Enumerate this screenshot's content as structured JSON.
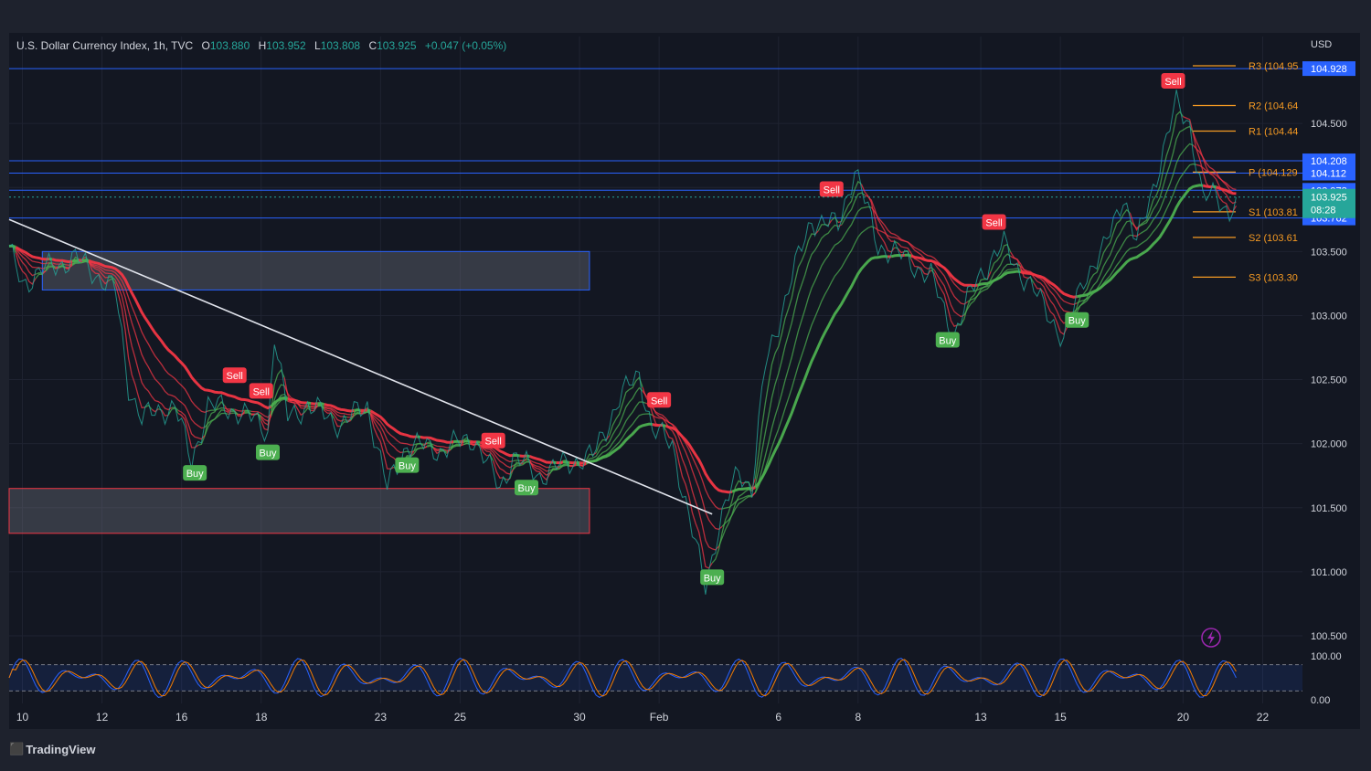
{
  "header": {
    "symbol": "U.S. Dollar Currency Index, 1h, TVC",
    "o_label": "O",
    "o": "103.880",
    "h_label": "H",
    "h": "103.952",
    "l_label": "L",
    "l": "103.808",
    "c_label": "C",
    "c": "103.925",
    "change": "+0.047 (+0.05%)"
  },
  "currency": "USD",
  "footer": {
    "brand": "TradingView"
  },
  "colors": {
    "background": "#131722",
    "frame": "#1e222d",
    "up": "#26a69a",
    "red": "#f23645",
    "green": "#4caf50",
    "orange": "#f59a23",
    "blue": "#2962ff",
    "text": "#b2b5be"
  },
  "chart_data": {
    "type": "line",
    "ylim": [
      100.4,
      105.05
    ],
    "y_ticks": [
      {
        "value": 104.5,
        "label": "104.500"
      },
      {
        "value": 104.0,
        "label": "104.000"
      },
      {
        "value": 103.5,
        "label": "103.500"
      },
      {
        "value": 103.0,
        "label": "103.000"
      },
      {
        "value": 102.5,
        "label": "102.500"
      },
      {
        "value": 102.0,
        "label": "102.000"
      },
      {
        "value": 101.5,
        "label": "101.500"
      },
      {
        "value": 101.0,
        "label": "101.000"
      },
      {
        "value": 100.5,
        "label": "100.500"
      }
    ],
    "x_ticks": [
      {
        "i": 4,
        "label": "10"
      },
      {
        "i": 28,
        "label": "12"
      },
      {
        "i": 52,
        "label": "16"
      },
      {
        "i": 76,
        "label": "18"
      },
      {
        "i": 112,
        "label": "23"
      },
      {
        "i": 136,
        "label": "25"
      },
      {
        "i": 172,
        "label": "30"
      },
      {
        "i": 196,
        "label": "Feb"
      },
      {
        "i": 232,
        "label": "6"
      },
      {
        "i": 256,
        "label": "8"
      },
      {
        "i": 293,
        "label": "13"
      },
      {
        "i": 317,
        "label": "15"
      },
      {
        "i": 354,
        "label": "20"
      },
      {
        "i": 378,
        "label": "22"
      }
    ],
    "n_slots": 390,
    "price_series": {
      "name": "DXY close",
      "anchors": [
        [
          0,
          103.5
        ],
        [
          4,
          103.25
        ],
        [
          10,
          103.35
        ],
        [
          20,
          103.45
        ],
        [
          32,
          103.2
        ],
        [
          36,
          102.45
        ],
        [
          40,
          102.2
        ],
        [
          50,
          102.3
        ],
        [
          55,
          101.85
        ],
        [
          60,
          102.3
        ],
        [
          70,
          102.25
        ],
        [
          78,
          102.1
        ],
        [
          80,
          102.85
        ],
        [
          84,
          102.2
        ],
        [
          90,
          102.3
        ],
        [
          100,
          102.15
        ],
        [
          108,
          102.3
        ],
        [
          114,
          101.65
        ],
        [
          120,
          102.0
        ],
        [
          130,
          101.95
        ],
        [
          140,
          102.05
        ],
        [
          148,
          101.65
        ],
        [
          152,
          101.9
        ],
        [
          160,
          101.75
        ],
        [
          168,
          101.85
        ],
        [
          176,
          101.9
        ],
        [
          184,
          102.35
        ],
        [
          190,
          102.55
        ],
        [
          194,
          102.1
        ],
        [
          200,
          102.0
        ],
        [
          206,
          101.3
        ],
        [
          210,
          100.9
        ],
        [
          214,
          101.35
        ],
        [
          220,
          101.8
        ],
        [
          224,
          101.65
        ],
        [
          228,
          102.6
        ],
        [
          236,
          103.3
        ],
        [
          242,
          103.75
        ],
        [
          250,
          103.7
        ],
        [
          255,
          104.15
        ],
        [
          262,
          103.55
        ],
        [
          270,
          103.45
        ],
        [
          278,
          103.3
        ],
        [
          285,
          102.85
        ],
        [
          292,
          103.3
        ],
        [
          300,
          103.55
        ],
        [
          306,
          103.3
        ],
        [
          314,
          103.0
        ],
        [
          318,
          102.8
        ],
        [
          324,
          103.3
        ],
        [
          330,
          103.5
        ],
        [
          336,
          103.95
        ],
        [
          340,
          103.55
        ],
        [
          346,
          104.1
        ],
        [
          352,
          104.65
        ],
        [
          356,
          104.5
        ],
        [
          360,
          103.9
        ],
        [
          364,
          103.95
        ],
        [
          368,
          103.8
        ],
        [
          370,
          103.925
        ]
      ]
    },
    "stoch_rsi": {
      "ylim": [
        0,
        100
      ],
      "ticks": [
        {
          "value": 100,
          "label": "100.00"
        },
        {
          "value": 0,
          "label": "0.00"
        }
      ],
      "bands": [
        80,
        20
      ]
    },
    "horizontal_levels": [
      {
        "name": "R3",
        "value": 104.95,
        "label": "R3 (104.95"
      },
      {
        "name": "R2",
        "value": 104.64,
        "label": "R2 (104.64"
      },
      {
        "name": "R1",
        "value": 104.44,
        "label": "R1 (104.44"
      },
      {
        "name": "P",
        "value": 104.12,
        "label": "P (104.129"
      },
      {
        "name": "S1",
        "value": 103.81,
        "label": "S1 (103.81"
      },
      {
        "name": "S2",
        "value": 103.61,
        "label": "S2 (103.61"
      },
      {
        "name": "S3",
        "value": 103.3,
        "label": "S3 (103.30"
      }
    ],
    "price_lines": [
      {
        "value": 104.928,
        "label": "104.928",
        "color": "#2962ff"
      },
      {
        "value": 104.208,
        "label": "104.208",
        "color": "#2962ff"
      },
      {
        "value": 104.112,
        "label": "104.112",
        "color": "#2962ff"
      },
      {
        "value": 103.978,
        "label": "103.978",
        "color": "#2962ff"
      },
      {
        "value": 103.762,
        "label": "103.762",
        "color": "#2962ff"
      }
    ],
    "last_price": {
      "value": 103.925,
      "label": "103.925",
      "countdown": "08:28"
    },
    "zones": [
      {
        "x0": 10,
        "x1": 175,
        "top": 103.5,
        "bottom": 103.2,
        "kind": "resistance"
      },
      {
        "x0": 0,
        "x1": 175,
        "top": 101.65,
        "bottom": 101.3,
        "kind": "support"
      }
    ],
    "trendline": {
      "from": [
        0,
        103.75
      ],
      "to": [
        212,
        101.45
      ]
    },
    "signals": [
      {
        "i": 76,
        "type": "Sell",
        "label": "Sell"
      },
      {
        "i": 68,
        "type": "Sell",
        "label": "Sell"
      },
      {
        "i": 146,
        "type": "Sell",
        "label": "Sell"
      },
      {
        "i": 196,
        "type": "Sell",
        "label": "Sell"
      },
      {
        "i": 248,
        "type": "Sell",
        "label": "Sell"
      },
      {
        "i": 297,
        "type": "Sell",
        "label": "Sell"
      },
      {
        "i": 351,
        "type": "Sell",
        "label": "Sell"
      },
      {
        "i": 56,
        "type": "Buy",
        "label": "Buy"
      },
      {
        "i": 78,
        "type": "Buy",
        "label": "Buy"
      },
      {
        "i": 120,
        "type": "Buy",
        "label": "Buy"
      },
      {
        "i": 156,
        "type": "Buy",
        "label": "Buy"
      },
      {
        "i": 212,
        "type": "Buy",
        "label": "Buy"
      },
      {
        "i": 283,
        "type": "Buy",
        "label": "Buy"
      },
      {
        "i": 322,
        "type": "Buy",
        "label": "Buy"
      }
    ]
  }
}
